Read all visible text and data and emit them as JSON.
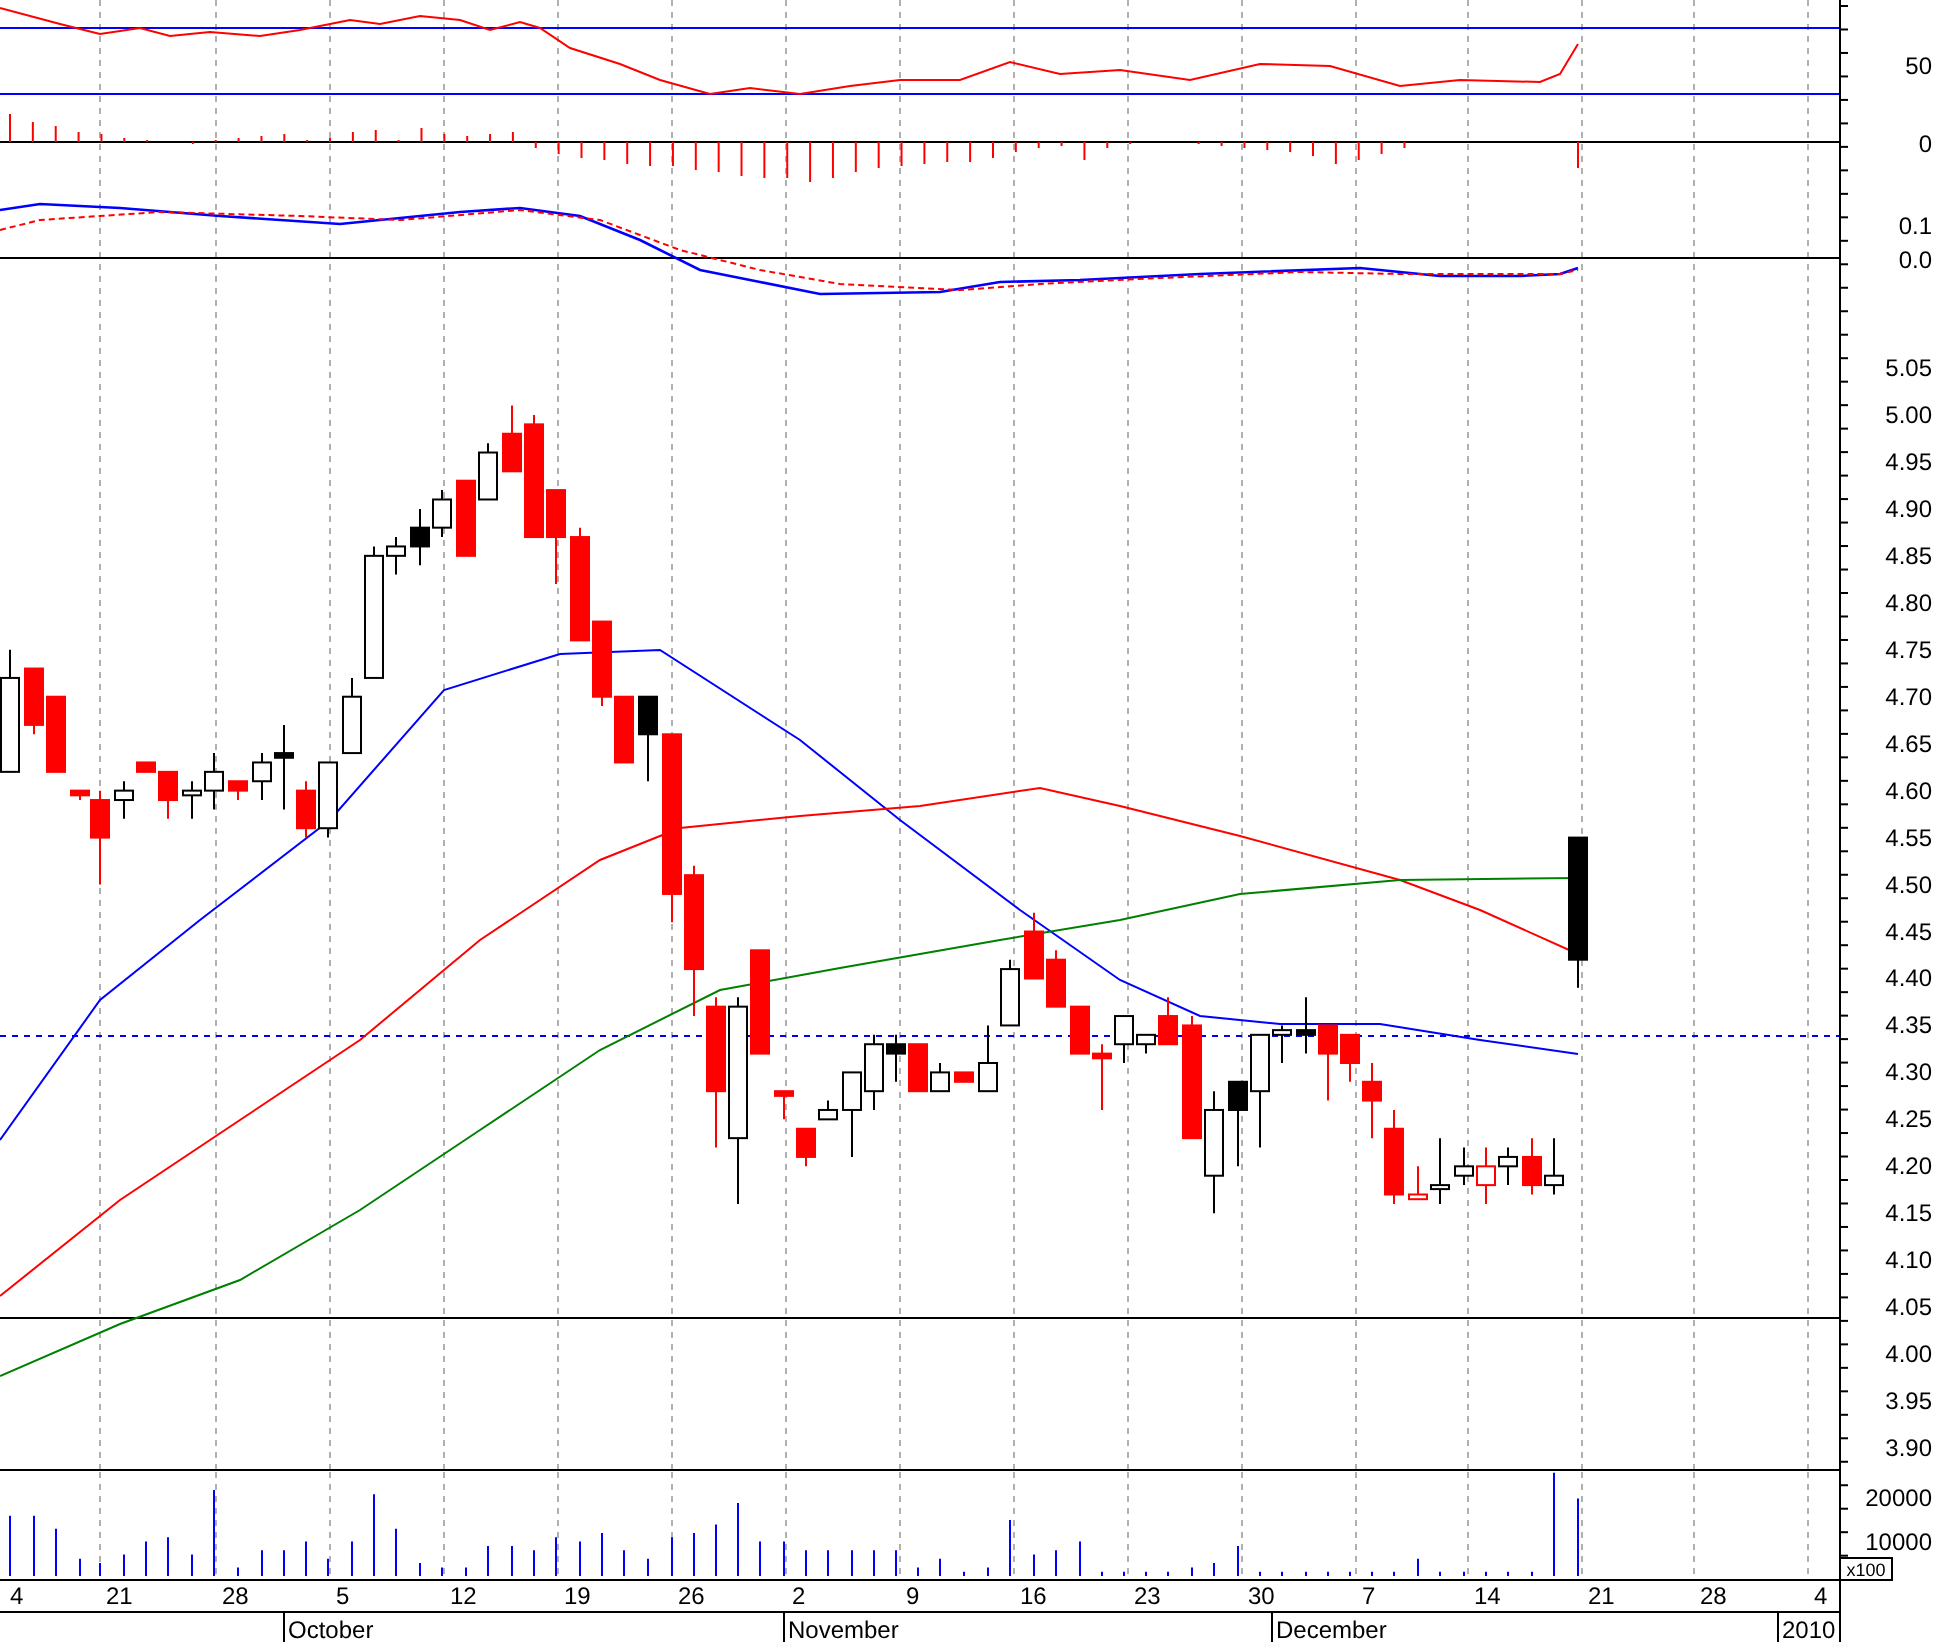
{
  "indicator_axis": [
    "50",
    "0",
    "0.1",
    "0.0"
  ],
  "price_axis": [
    "5.05",
    "5.00",
    "4.95",
    "4.90",
    "4.85",
    "4.80",
    "4.75",
    "4.70",
    "4.65",
    "4.60",
    "4.55",
    "4.50",
    "4.45",
    "4.40",
    "4.35",
    "4.30",
    "4.25",
    "4.20",
    "4.15",
    "4.10",
    "4.05",
    "4.00",
    "3.95",
    "3.90"
  ],
  "volume_axis": [
    "20000",
    "10000"
  ],
  "volume_unit": "x100",
  "date_labels": [
    "4",
    "21",
    "28",
    "5",
    "12",
    "19",
    "26",
    "2",
    "9",
    "16",
    "23",
    "30",
    "7",
    "14",
    "21",
    "28",
    "4"
  ],
  "month_labels": [
    "October",
    "November",
    "December",
    "2010"
  ]
}
